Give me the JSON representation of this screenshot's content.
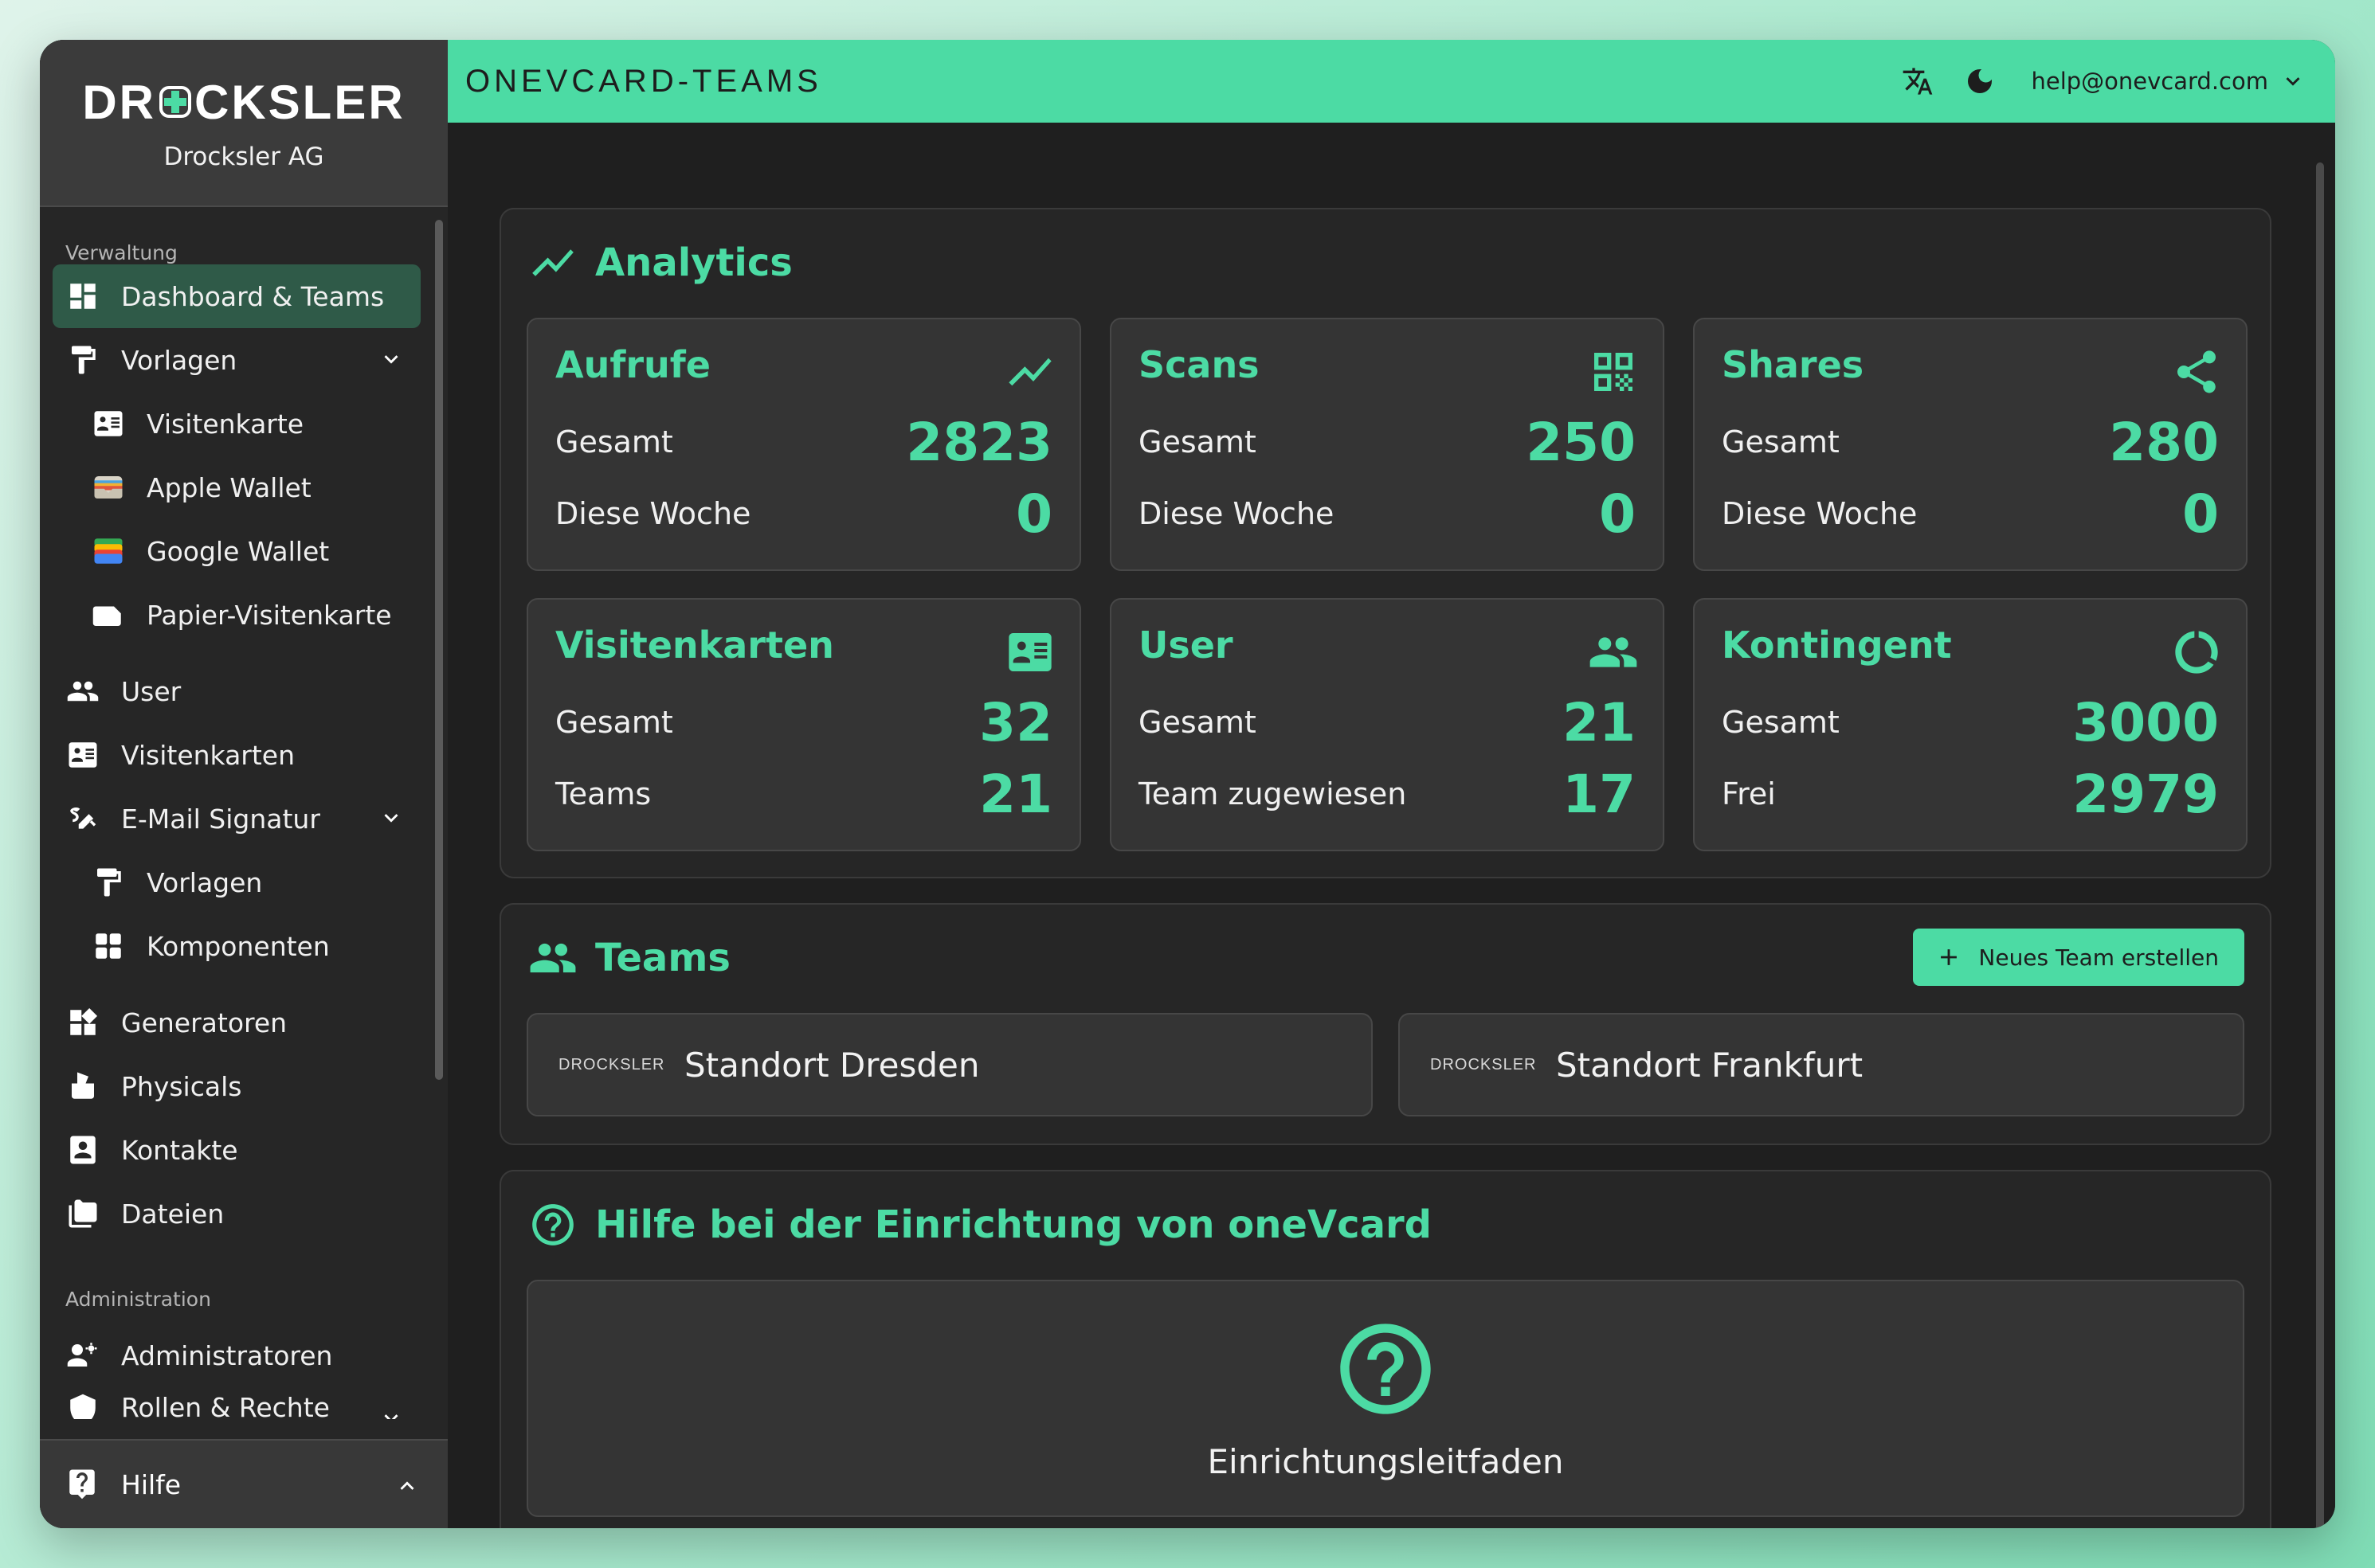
{
  "brand": {
    "logo_text_left": "DR",
    "logo_text_right": "CKSLER",
    "company": "Drocksler AG"
  },
  "header": {
    "title": "ONEVCARD-TEAMS",
    "translate_icon": "translate-icon",
    "theme_icon": "moon-icon",
    "account_email": "help@onevcard.com"
  },
  "sidebar": {
    "section_verwaltung": "Verwaltung",
    "section_administration": "Administration",
    "items": [
      {
        "label": "Dashboard & Teams",
        "icon": "dashboard-icon"
      },
      {
        "label": "Vorlagen",
        "icon": "paint-roller-icon"
      },
      {
        "label": "Visitenkarte",
        "icon": "contact-card-icon"
      },
      {
        "label": "Apple Wallet",
        "icon": "apple-wallet-icon"
      },
      {
        "label": "Google Wallet",
        "icon": "google-wallet-icon"
      },
      {
        "label": "Papier-Visitenkarte",
        "icon": "paper-card-icon"
      },
      {
        "label": "User",
        "icon": "users-icon"
      },
      {
        "label": "Visitenkarten",
        "icon": "contact-card-icon"
      },
      {
        "label": "E-Mail Signatur",
        "icon": "signature-icon"
      },
      {
        "label": "Vorlagen",
        "icon": "paint-roller-icon"
      },
      {
        "label": "Komponenten",
        "icon": "grid-icon"
      },
      {
        "label": "Generatoren",
        "icon": "widgets-icon"
      },
      {
        "label": "Physicals",
        "icon": "hand-card-icon"
      },
      {
        "label": "Kontakte",
        "icon": "contacts-icon"
      },
      {
        "label": "Dateien",
        "icon": "folder-icon"
      },
      {
        "label": "Administratoren",
        "icon": "admin-users-icon"
      },
      {
        "label": "Rollen & Rechte",
        "icon": "shield-icon"
      }
    ],
    "footer_label": "Hilfe"
  },
  "analytics": {
    "title": "Analytics",
    "cards": [
      {
        "title": "Aufrufe",
        "icon": "trending-icon",
        "row1_label": "Gesamt",
        "row1_value": "2823",
        "row2_label": "Diese Woche",
        "row2_value": "0"
      },
      {
        "title": "Scans",
        "icon": "qr-code-icon",
        "row1_label": "Gesamt",
        "row1_value": "250",
        "row2_label": "Diese Woche",
        "row2_value": "0"
      },
      {
        "title": "Shares",
        "icon": "share-icon",
        "row1_label": "Gesamt",
        "row1_value": "280",
        "row2_label": "Diese Woche",
        "row2_value": "0"
      },
      {
        "title": "Visitenkarten",
        "icon": "contact-card-icon",
        "row1_label": "Gesamt",
        "row1_value": "32",
        "row2_label": "Teams",
        "row2_value": "21"
      },
      {
        "title": "User",
        "icon": "users-icon",
        "row1_label": "Gesamt",
        "row1_value": "21",
        "row2_label": "Team zugewiesen",
        "row2_value": "17"
      },
      {
        "title": "Kontingent",
        "icon": "donut-icon",
        "row1_label": "Gesamt",
        "row1_value": "3000",
        "row2_label": "Frei",
        "row2_value": "2979"
      }
    ]
  },
  "teams": {
    "title": "Teams",
    "new_button": "Neues Team erstellen",
    "list": [
      {
        "logo": "DROCKSLER",
        "name": "Standort Dresden"
      },
      {
        "logo": "DROCKSLER",
        "name": "Standort Frankfurt"
      }
    ]
  },
  "help": {
    "title": "Hilfe bei der Einrichtung von oneVcard",
    "guide_label": "Einrichtungsleitfaden"
  },
  "colors": {
    "accent": "#4cdba4",
    "background": "#1f1f1f",
    "card": "#343434",
    "sidebar": "#262626"
  }
}
